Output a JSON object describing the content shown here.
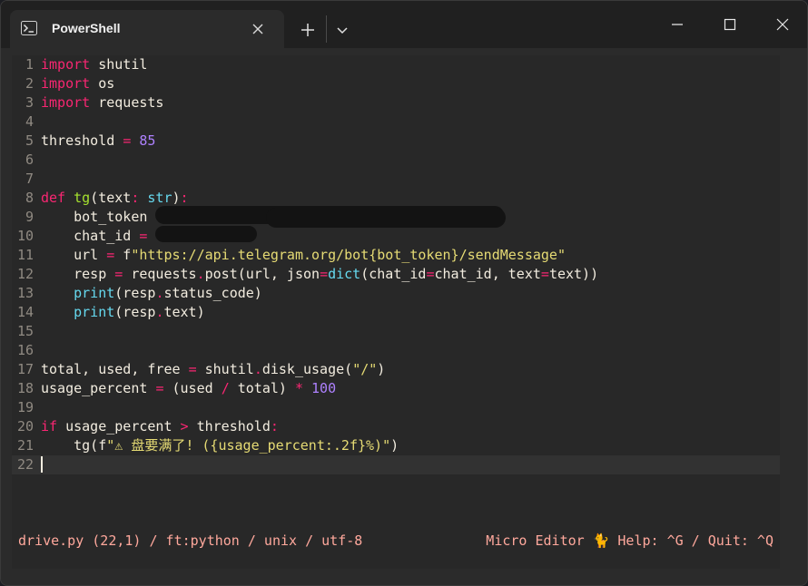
{
  "window": {
    "tab_title": "PowerShell",
    "tab_icon": "powershell-icon",
    "controls": [
      "minimize-icon",
      "maximize-icon",
      "close-icon"
    ]
  },
  "editor": {
    "lines": [
      {
        "n": "1",
        "tokens": [
          {
            "t": "import",
            "c": "kw"
          },
          {
            "t": " shutil",
            "c": ""
          }
        ]
      },
      {
        "n": "2",
        "tokens": [
          {
            "t": "import",
            "c": "kw"
          },
          {
            "t": " os",
            "c": ""
          }
        ]
      },
      {
        "n": "3",
        "tokens": [
          {
            "t": "import",
            "c": "kw"
          },
          {
            "t": " requests",
            "c": ""
          }
        ]
      },
      {
        "n": "4",
        "tokens": []
      },
      {
        "n": "5",
        "tokens": [
          {
            "t": "threshold ",
            "c": ""
          },
          {
            "t": "=",
            "c": "op"
          },
          {
            "t": " ",
            "c": ""
          },
          {
            "t": "85",
            "c": "num"
          }
        ]
      },
      {
        "n": "6",
        "tokens": []
      },
      {
        "n": "7",
        "tokens": []
      },
      {
        "n": "8",
        "tokens": [
          {
            "t": "def",
            "c": "kw"
          },
          {
            "t": " ",
            "c": ""
          },
          {
            "t": "tg",
            "c": "fn"
          },
          {
            "t": "(text",
            "c": ""
          },
          {
            "t": ":",
            "c": "op"
          },
          {
            "t": " ",
            "c": ""
          },
          {
            "t": "str",
            "c": "bi"
          },
          {
            "t": ")",
            "c": ""
          },
          {
            "t": ":",
            "c": "op"
          }
        ]
      },
      {
        "n": "9",
        "tokens": [
          {
            "t": "    bot_token ",
            "c": ""
          },
          {
            "t": "=",
            "c": "op"
          }
        ]
      },
      {
        "n": "10",
        "tokens": [
          {
            "t": "    chat_id ",
            "c": ""
          },
          {
            "t": "=",
            "c": "op"
          }
        ]
      },
      {
        "n": "11",
        "tokens": [
          {
            "t": "    url ",
            "c": ""
          },
          {
            "t": "=",
            "c": "op"
          },
          {
            "t": " f",
            "c": ""
          },
          {
            "t": "\"https://api.telegram.org/bot{bot_token}/sendMessage\"",
            "c": "str"
          }
        ]
      },
      {
        "n": "12",
        "tokens": [
          {
            "t": "    resp ",
            "c": ""
          },
          {
            "t": "=",
            "c": "op"
          },
          {
            "t": " requests",
            "c": ""
          },
          {
            "t": ".",
            "c": "op"
          },
          {
            "t": "post(url, json",
            "c": ""
          },
          {
            "t": "=",
            "c": "op"
          },
          {
            "t": "dict",
            "c": "bi"
          },
          {
            "t": "(chat_id",
            "c": ""
          },
          {
            "t": "=",
            "c": "op"
          },
          {
            "t": "chat_id, text",
            "c": ""
          },
          {
            "t": "=",
            "c": "op"
          },
          {
            "t": "text))",
            "c": ""
          }
        ]
      },
      {
        "n": "13",
        "tokens": [
          {
            "t": "    ",
            "c": ""
          },
          {
            "t": "print",
            "c": "bi"
          },
          {
            "t": "(resp",
            "c": ""
          },
          {
            "t": ".",
            "c": "op"
          },
          {
            "t": "status_code)",
            "c": ""
          }
        ]
      },
      {
        "n": "14",
        "tokens": [
          {
            "t": "    ",
            "c": ""
          },
          {
            "t": "print",
            "c": "bi"
          },
          {
            "t": "(resp",
            "c": ""
          },
          {
            "t": ".",
            "c": "op"
          },
          {
            "t": "text)",
            "c": ""
          }
        ]
      },
      {
        "n": "15",
        "tokens": []
      },
      {
        "n": "16",
        "tokens": []
      },
      {
        "n": "17",
        "tokens": [
          {
            "t": "total, used, free ",
            "c": ""
          },
          {
            "t": "=",
            "c": "op"
          },
          {
            "t": " shutil",
            "c": ""
          },
          {
            "t": ".",
            "c": "op"
          },
          {
            "t": "disk_usage(",
            "c": ""
          },
          {
            "t": "\"/\"",
            "c": "str"
          },
          {
            "t": ")",
            "c": ""
          }
        ]
      },
      {
        "n": "18",
        "tokens": [
          {
            "t": "usage_percent ",
            "c": ""
          },
          {
            "t": "=",
            "c": "op"
          },
          {
            "t": " (used ",
            "c": ""
          },
          {
            "t": "/",
            "c": "op"
          },
          {
            "t": " total) ",
            "c": ""
          },
          {
            "t": "*",
            "c": "op"
          },
          {
            "t": " ",
            "c": ""
          },
          {
            "t": "100",
            "c": "num"
          }
        ]
      },
      {
        "n": "19",
        "tokens": []
      },
      {
        "n": "20",
        "tokens": [
          {
            "t": "if",
            "c": "kw"
          },
          {
            "t": " usage_percent ",
            "c": ""
          },
          {
            "t": ">",
            "c": "op"
          },
          {
            "t": " threshold",
            "c": ""
          },
          {
            "t": ":",
            "c": "op"
          }
        ]
      },
      {
        "n": "21",
        "tokens": [
          {
            "t": "    tg(f",
            "c": ""
          },
          {
            "t": "\"⚠ 盘要满了! ({usage_percent:.2f}%)\"",
            "c": "str"
          },
          {
            "t": ")",
            "c": ""
          }
        ]
      },
      {
        "n": "22",
        "tokens": [],
        "current": true
      }
    ]
  },
  "statusbar": {
    "left": "drive.py (22,1) / ft:python / unix / utf-8",
    "right": "Micro Editor 🐈 Help: ^G / Quit: ^Q"
  }
}
